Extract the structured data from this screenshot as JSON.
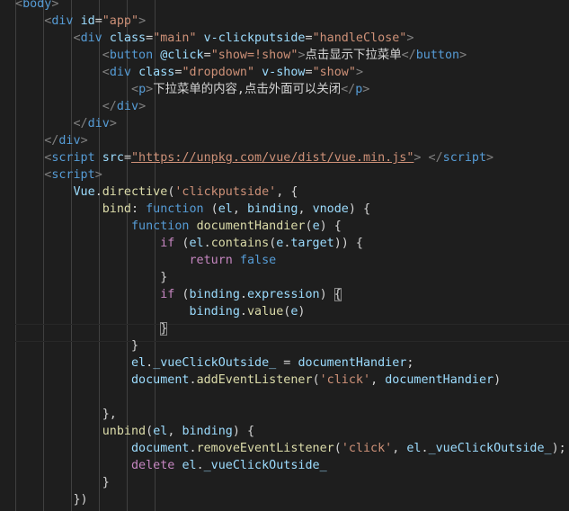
{
  "editor": {
    "lines": [
      [
        [
          "t-punct",
          "<"
        ],
        [
          "t-tag",
          "body"
        ],
        [
          "t-punct",
          ">"
        ]
      ],
      [
        [
          "t-text",
          "    "
        ],
        [
          "t-punct",
          "<"
        ],
        [
          "t-tag",
          "div"
        ],
        [
          "t-text",
          " "
        ],
        [
          "t-attr",
          "id"
        ],
        [
          "t-text",
          "="
        ],
        [
          "t-str",
          "\"app\""
        ],
        [
          "t-punct",
          ">"
        ]
      ],
      [
        [
          "t-text",
          "        "
        ],
        [
          "t-punct",
          "<"
        ],
        [
          "t-tag",
          "div"
        ],
        [
          "t-text",
          " "
        ],
        [
          "t-attr",
          "class"
        ],
        [
          "t-text",
          "="
        ],
        [
          "t-str",
          "\"main\""
        ],
        [
          "t-text",
          " "
        ],
        [
          "t-attr",
          "v-clickputside"
        ],
        [
          "t-text",
          "="
        ],
        [
          "t-str",
          "\"handleClose\""
        ],
        [
          "t-punct",
          ">"
        ]
      ],
      [
        [
          "t-text",
          "            "
        ],
        [
          "t-punct",
          "<"
        ],
        [
          "t-tag",
          "button"
        ],
        [
          "t-text",
          " "
        ],
        [
          "t-attr",
          "@click"
        ],
        [
          "t-text",
          "="
        ],
        [
          "t-str",
          "\"show=!show\""
        ],
        [
          "t-punct",
          ">"
        ],
        [
          "t-text",
          "点击显示下拉菜单"
        ],
        [
          "t-punct",
          "</"
        ],
        [
          "t-tag",
          "button"
        ],
        [
          "t-punct",
          ">"
        ]
      ],
      [
        [
          "t-text",
          "            "
        ],
        [
          "t-punct",
          "<"
        ],
        [
          "t-tag",
          "div"
        ],
        [
          "t-text",
          " "
        ],
        [
          "t-attr",
          "class"
        ],
        [
          "t-text",
          "="
        ],
        [
          "t-str",
          "\"dropdown\""
        ],
        [
          "t-text",
          " "
        ],
        [
          "t-attr",
          "v-show"
        ],
        [
          "t-text",
          "="
        ],
        [
          "t-str",
          "\"show\""
        ],
        [
          "t-punct",
          ">"
        ]
      ],
      [
        [
          "t-text",
          "                "
        ],
        [
          "t-punct",
          "<"
        ],
        [
          "t-tag",
          "p"
        ],
        [
          "t-punct",
          ">"
        ],
        [
          "t-text",
          "下拉菜单的内容,点击外面可以关闭"
        ],
        [
          "t-punct",
          "</"
        ],
        [
          "t-tag",
          "p"
        ],
        [
          "t-punct",
          ">"
        ]
      ],
      [
        [
          "t-text",
          "            "
        ],
        [
          "t-punct",
          "</"
        ],
        [
          "t-tag",
          "div"
        ],
        [
          "t-punct",
          ">"
        ]
      ],
      [
        [
          "t-text",
          "        "
        ],
        [
          "t-punct",
          "</"
        ],
        [
          "t-tag",
          "div"
        ],
        [
          "t-punct",
          ">"
        ]
      ],
      [
        [
          "t-text",
          "    "
        ],
        [
          "t-punct",
          "</"
        ],
        [
          "t-tag",
          "div"
        ],
        [
          "t-punct",
          ">"
        ]
      ],
      [
        [
          "t-text",
          "    "
        ],
        [
          "t-punct",
          "<"
        ],
        [
          "t-tag",
          "script"
        ],
        [
          "t-text",
          " "
        ],
        [
          "t-attr",
          "src"
        ],
        [
          "t-text",
          "="
        ],
        [
          "t-link",
          "\"https://unpkg.com/vue/dist/vue.min.js\""
        ],
        [
          "t-punct",
          ">"
        ],
        [
          "t-text",
          " "
        ],
        [
          "t-punct",
          "</"
        ],
        [
          "t-tag",
          "script"
        ],
        [
          "t-punct",
          ">"
        ]
      ],
      [
        [
          "t-text",
          "    "
        ],
        [
          "t-punct",
          "<"
        ],
        [
          "t-tag",
          "script"
        ],
        [
          "t-punct",
          ">"
        ]
      ],
      [
        [
          "t-text",
          "        "
        ],
        [
          "t-obj",
          "Vue"
        ],
        [
          "t-text",
          "."
        ],
        [
          "t-fn",
          "directive"
        ],
        [
          "t-text",
          "("
        ],
        [
          "t-str",
          "'clickputside'"
        ],
        [
          "t-text",
          ", {"
        ]
      ],
      [
        [
          "t-text",
          "            "
        ],
        [
          "t-fn",
          "bind"
        ],
        [
          "t-text",
          ": "
        ],
        [
          "t-kw",
          "function"
        ],
        [
          "t-text",
          " ("
        ],
        [
          "t-var",
          "el"
        ],
        [
          "t-text",
          ", "
        ],
        [
          "t-var",
          "binding"
        ],
        [
          "t-text",
          ", "
        ],
        [
          "t-var",
          "vnode"
        ],
        [
          "t-text",
          ") {"
        ]
      ],
      [
        [
          "t-text",
          "                "
        ],
        [
          "t-kw",
          "function"
        ],
        [
          "t-text",
          " "
        ],
        [
          "t-fn",
          "documentHandier"
        ],
        [
          "t-text",
          "("
        ],
        [
          "t-var",
          "e"
        ],
        [
          "t-text",
          ") {"
        ]
      ],
      [
        [
          "t-text",
          "                    "
        ],
        [
          "t-ctrl",
          "if"
        ],
        [
          "t-text",
          " ("
        ],
        [
          "t-var",
          "el"
        ],
        [
          "t-text",
          "."
        ],
        [
          "t-fn",
          "contains"
        ],
        [
          "t-text",
          "("
        ],
        [
          "t-var",
          "e"
        ],
        [
          "t-text",
          "."
        ],
        [
          "t-var",
          "target"
        ],
        [
          "t-text",
          ")) {"
        ]
      ],
      [
        [
          "t-text",
          "                        "
        ],
        [
          "t-ctrl",
          "return"
        ],
        [
          "t-text",
          " "
        ],
        [
          "t-kw",
          "false"
        ]
      ],
      [
        [
          "t-text",
          "                    }"
        ]
      ],
      [
        [
          "t-text",
          "                    "
        ],
        [
          "t-ctrl",
          "if"
        ],
        [
          "t-text",
          " ("
        ],
        [
          "t-var",
          "binding"
        ],
        [
          "t-text",
          "."
        ],
        [
          "t-var",
          "expression"
        ],
        [
          "t-text",
          ") "
        ],
        [
          "t-brace bracket-match",
          "{"
        ]
      ],
      [
        [
          "t-text",
          "                        "
        ],
        [
          "t-var",
          "binding"
        ],
        [
          "t-text",
          "."
        ],
        [
          "t-fn",
          "value"
        ],
        [
          "t-text",
          "("
        ],
        [
          "t-var",
          "e"
        ],
        [
          "t-text",
          ")"
        ]
      ],
      [
        [
          "t-text",
          "                    "
        ],
        [
          "t-brace bracket-match",
          "}"
        ]
      ],
      [
        [
          "t-text",
          "                }"
        ]
      ],
      [
        [
          "t-text",
          "                "
        ],
        [
          "t-var",
          "el"
        ],
        [
          "t-text",
          "."
        ],
        [
          "t-var",
          "_vueClickOutside_"
        ],
        [
          "t-text",
          " = "
        ],
        [
          "t-var",
          "documentHandier"
        ],
        [
          "t-text",
          ";"
        ]
      ],
      [
        [
          "t-text",
          "                "
        ],
        [
          "t-var",
          "document"
        ],
        [
          "t-text",
          "."
        ],
        [
          "t-fn",
          "addEventListener"
        ],
        [
          "t-text",
          "("
        ],
        [
          "t-str",
          "'click'"
        ],
        [
          "t-text",
          ", "
        ],
        [
          "t-var",
          "documentHandier"
        ],
        [
          "t-text",
          ")"
        ]
      ],
      [
        [
          "t-text",
          ""
        ]
      ],
      [
        [
          "t-text",
          "            },"
        ]
      ],
      [
        [
          "t-text",
          "            "
        ],
        [
          "t-fn",
          "unbind"
        ],
        [
          "t-text",
          "("
        ],
        [
          "t-var",
          "el"
        ],
        [
          "t-text",
          ", "
        ],
        [
          "t-var",
          "binding"
        ],
        [
          "t-text",
          ") {"
        ]
      ],
      [
        [
          "t-text",
          "                "
        ],
        [
          "t-var",
          "document"
        ],
        [
          "t-text",
          "."
        ],
        [
          "t-fn",
          "removeEventListener"
        ],
        [
          "t-text",
          "("
        ],
        [
          "t-str",
          "'click'"
        ],
        [
          "t-text",
          ", "
        ],
        [
          "t-var",
          "el"
        ],
        [
          "t-text",
          "."
        ],
        [
          "t-var",
          "_vueClickOutside_"
        ],
        [
          "t-text",
          ");"
        ]
      ],
      [
        [
          "t-text",
          "                "
        ],
        [
          "t-ctrl",
          "delete"
        ],
        [
          "t-text",
          " "
        ],
        [
          "t-var",
          "el"
        ],
        [
          "t-text",
          "."
        ],
        [
          "t-var",
          "_vueClickOutside_"
        ]
      ],
      [
        [
          "t-text",
          "            }"
        ]
      ],
      [
        [
          "t-text",
          "        })"
        ]
      ]
    ]
  }
}
